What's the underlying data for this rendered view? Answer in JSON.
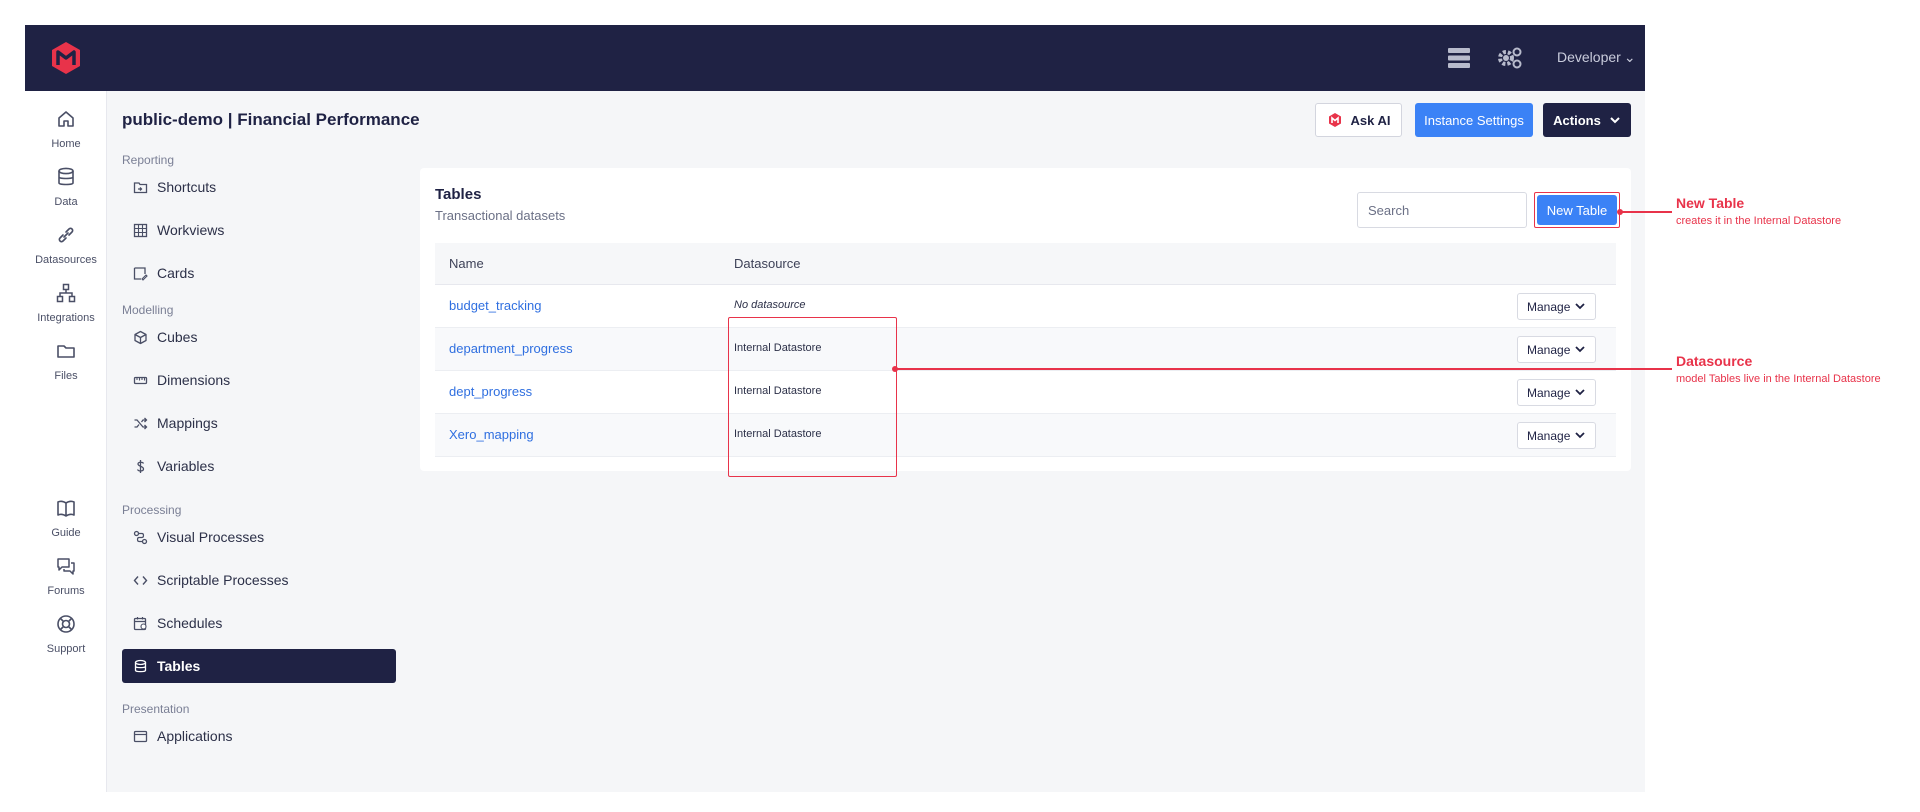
{
  "topbar": {
    "user_label": "Developer"
  },
  "rail": [
    {
      "label": "Home"
    },
    {
      "label": "Data"
    },
    {
      "label": "Datasources"
    },
    {
      "label": "Integrations"
    },
    {
      "label": "Files"
    },
    {
      "label": "Guide"
    },
    {
      "label": "Forums"
    },
    {
      "label": "Support"
    }
  ],
  "header": {
    "title": "public-demo | Financial Performance",
    "ask_ai": "Ask AI",
    "instance_settings": "Instance Settings",
    "actions": "Actions"
  },
  "sidebar": {
    "sections": [
      "Reporting",
      "Modelling",
      "Processing",
      "Presentation"
    ],
    "items": [
      {
        "label": "Shortcuts",
        "icon": "shortcuts-icon"
      },
      {
        "label": "Workviews",
        "icon": "grid-icon"
      },
      {
        "label": "Cards",
        "icon": "card-icon"
      },
      {
        "label": "Cubes",
        "icon": "cube-icon"
      },
      {
        "label": "Dimensions",
        "icon": "ruler-icon"
      },
      {
        "label": "Mappings",
        "icon": "shuffle-icon"
      },
      {
        "label": "Variables",
        "icon": "dollar-icon"
      },
      {
        "label": "Visual Processes",
        "icon": "flow-icon"
      },
      {
        "label": "Scriptable Processes",
        "icon": "code-icon"
      },
      {
        "label": "Schedules",
        "icon": "calendar-icon"
      },
      {
        "label": "Tables",
        "icon": "database-icon",
        "active": true
      },
      {
        "label": "Applications",
        "icon": "window-icon"
      }
    ]
  },
  "panel": {
    "title": "Tables",
    "subtitle": "Transactional datasets",
    "search_placeholder": "Search",
    "new_table": "New Table",
    "columns": [
      "Name",
      "Datasource"
    ],
    "rows": [
      {
        "name": "budget_tracking",
        "datasource": "No datasource",
        "manage": "Manage"
      },
      {
        "name": "department_progress",
        "datasource": "Internal Datastore",
        "manage": "Manage"
      },
      {
        "name": "dept_progress",
        "datasource": "Internal Datastore",
        "manage": "Manage"
      },
      {
        "name": "Xero_mapping",
        "datasource": "Internal Datastore",
        "manage": "Manage"
      }
    ]
  },
  "annotations": {
    "new_table": {
      "title": "New Table",
      "text": "creates it in the Internal Datastore"
    },
    "datasource": {
      "title": "Datasource",
      "text": "model Tables live in the Internal Datastore"
    }
  },
  "colors": {
    "nav_dark": "#1f2244",
    "primary": "#3b82f6",
    "accent": "#e8334a"
  }
}
